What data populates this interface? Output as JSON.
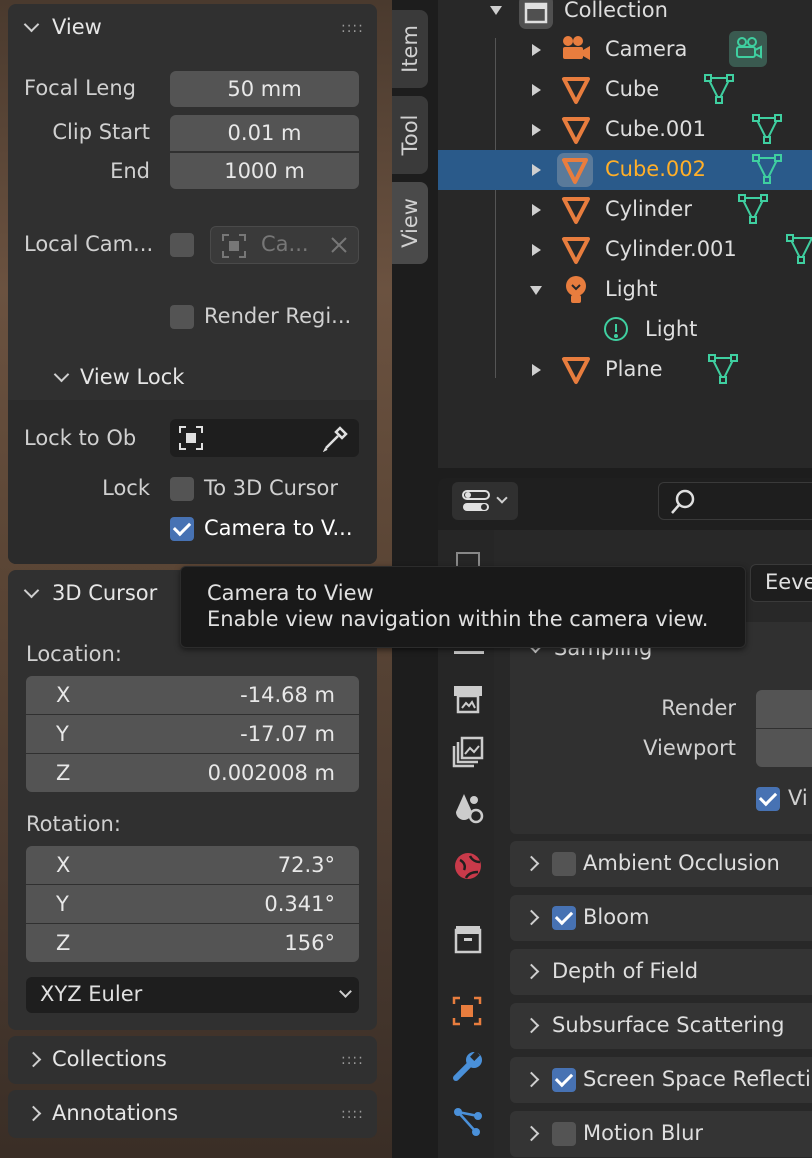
{
  "npanel": {
    "view": {
      "title": "View",
      "focal_label": "Focal Leng",
      "focal_value": "50 mm",
      "clip_start_label": "Clip Start",
      "clip_start_value": "0.01 m",
      "end_label": "End",
      "end_value": "1000 m",
      "local_cam_label": "Local Cam...",
      "local_cam_field": "Ca...",
      "render_region_label": "Render Regi...",
      "view_lock_title": "View Lock",
      "lock_to_ob_label": "Lock to Ob",
      "lock_label": "Lock",
      "to_3d_cursor_label": "To 3D Cursor",
      "camera_to_view_label": "Camera to V...",
      "camera_to_view_checked": true,
      "to_3d_cursor_checked": false,
      "render_region_checked": false,
      "local_cam_checked": false
    },
    "cursor": {
      "title": "3D Cursor",
      "location_label": "Location:",
      "loc_x_axis": "X",
      "loc_x": "-14.68 m",
      "loc_y_axis": "Y",
      "loc_y": "-17.07 m",
      "loc_z_axis": "Z",
      "loc_z": "0.002008 m",
      "rotation_label": "Rotation:",
      "rot_x_axis": "X",
      "rot_x": "72.3°",
      "rot_y_axis": "Y",
      "rot_y": "0.341°",
      "rot_z_axis": "Z",
      "rot_z": "156°",
      "rotation_mode": "XYZ Euler"
    },
    "collections_title": "Collections",
    "annotations_title": "Annotations"
  },
  "side_tabs": {
    "item": "Item",
    "tool": "Tool",
    "view": "View"
  },
  "outliner": {
    "collection": "Collection",
    "rows": [
      "Camera",
      "Cube",
      "Cube.001",
      "Cube.002",
      "Cylinder",
      "Cylinder.001",
      "Light",
      "Light",
      "Plane"
    ],
    "selected": "Cube.002"
  },
  "properties": {
    "engine": "Eeve",
    "sampling_title": "Sampling",
    "render_label": "Render",
    "viewport_label": "Viewport",
    "viewport_denoise_label": "Vi",
    "sections": {
      "ambient_occlusion": "Ambient Occlusion",
      "bloom": "Bloom",
      "depth_of_field": "Depth of Field",
      "subsurface": "Subsurface Scattering",
      "ssr": "Screen Space Reflecti",
      "motion_blur": "Motion Blur"
    },
    "bloom_checked": true,
    "ssr_checked": true,
    "ao_checked": false,
    "motion_blur_checked": false
  },
  "tooltip": {
    "title": "Camera to View",
    "description": "Enable view navigation within the camera view."
  },
  "colors": {
    "accent_blue": "#4772b3",
    "selection_blue": "#2a5a8a",
    "object_orange": "#e87d3e",
    "mesh_green": "#3fcfa0",
    "selected_text": "#ffaf29"
  }
}
